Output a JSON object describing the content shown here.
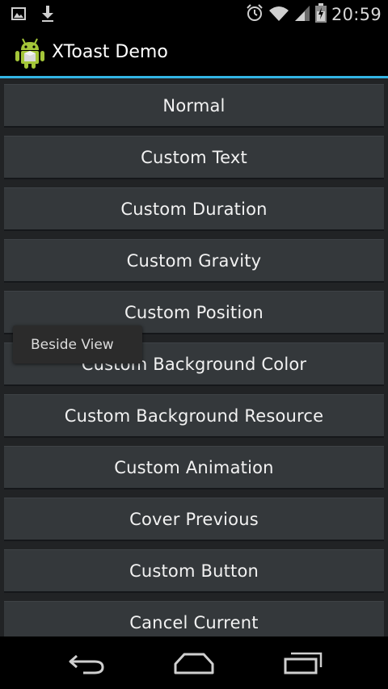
{
  "status_bar": {
    "time": "20:59",
    "icons": [
      "image-icon",
      "download-icon",
      "alarm-icon",
      "wifi-icon",
      "signal-icon",
      "battery-icon"
    ]
  },
  "action_bar": {
    "title": "XToast Demo",
    "logo": "android-robot-icon",
    "accent_color": "#33b5e5"
  },
  "buttons": [
    {
      "label": "Normal"
    },
    {
      "label": "Custom Text"
    },
    {
      "label": "Custom Duration"
    },
    {
      "label": "Custom Gravity"
    },
    {
      "label": "Custom Position"
    },
    {
      "label": "Custom Background Color"
    },
    {
      "label": "Custom Background Resource"
    },
    {
      "label": "Custom Animation"
    },
    {
      "label": "Cover Previous"
    },
    {
      "label": "Custom Button"
    },
    {
      "label": "Cancel Current"
    }
  ],
  "toast": {
    "text": "Beside View"
  },
  "nav_bar": {
    "items": [
      "back-icon",
      "home-icon",
      "recent-apps-icon"
    ]
  }
}
